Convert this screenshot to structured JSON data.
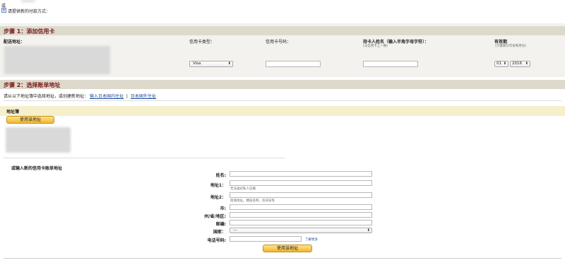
{
  "top": {
    "or_text": "或",
    "add_payment_label": "请提供新的付款方式："
  },
  "step1": {
    "title": "步骤 1：添加信用卡",
    "shipping_address_label": "配送地址：",
    "card_type_label": "信用卡类型：",
    "card_type_value": "Visa",
    "card_number_label": "信用卡号码：",
    "cardholder_label": "持卡人姓名（输入半角字母字符）：",
    "cardholder_hint": "(与信用卡上一致)",
    "expiry_label": "有效期",
    "expiry_hint": "(只需填写年份和月份)",
    "expiry_month": "01",
    "expiry_year": "2016"
  },
  "step2": {
    "title": "步骤 2：选择账单地址",
    "instruction": "请从以下地址簿中选择地址，或创建新地址：",
    "link_japan": "输入日本国内住址",
    "separator": "|",
    "link_foreign": "日本国外住址",
    "address_book_label": "地址簿",
    "use_address_button": "使用该地址",
    "new_address_heading": "或输入新的信用卡账单地址",
    "form": {
      "name_label": "姓名:",
      "address1_label": "地址1：",
      "address1_hint": "无法送达私人信箱",
      "address2_label": "地址2：",
      "address2_hint": "街道地址，楼层名称，房间号等",
      "city_label": "市:",
      "state_label": "州/省/地区:",
      "postal_label": "邮编:",
      "country_label": "国家：",
      "country_value": "---",
      "phone_label": "电话号码:",
      "phone_more": "了解更多",
      "submit_button": "使用该地址"
    }
  },
  "colors": {
    "step_title": "#7a1a1a",
    "bar_bg": "#ddd9cc",
    "addressbook_bg": "#f6efcc",
    "button_top": "#fde38a",
    "button_bottom": "#f2b530"
  }
}
